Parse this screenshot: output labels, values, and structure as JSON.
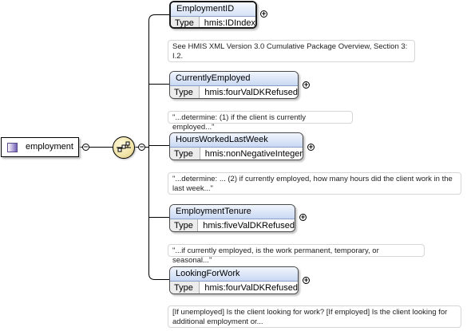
{
  "root": {
    "label": "employment",
    "icon": "complex-element-icon"
  },
  "sequence": {
    "icon": "sequence-compositor-icon"
  },
  "elements": [
    {
      "name": "EmploymentID",
      "type_label": "Type",
      "type_value": "hmis:IDIndex",
      "doc": "See HMIS XML Version 3.0 Cumulative Package Overview, Section 3: I.2."
    },
    {
      "name": "CurrentlyEmployed",
      "type_label": "Type",
      "type_value": "hmis:fourValDKRefused",
      "doc": "\"...determine: (1) if the client is currently employed...\""
    },
    {
      "name": "HoursWorkedLastWeek",
      "type_label": "Type",
      "type_value": "hmis:nonNegativeInteger",
      "doc": "\"...determine: ... (2) if currently employed, how many hours did the client work in the last week...\""
    },
    {
      "name": "EmploymentTenure",
      "type_label": "Type",
      "type_value": "hmis:fiveValDKRefused",
      "doc": "\"...if currently employed, is the work permanent, temporary, or seasonal...\""
    },
    {
      "name": "LookingForWork",
      "type_label": "Type",
      "type_value": "hmis:fourValDKRefused",
      "doc": "[If unemployed] Is the client looking for work? [If employed] Is the client looking for additional employment or..."
    }
  ],
  "toggles": {
    "collapse": "−",
    "expand": "+"
  }
}
